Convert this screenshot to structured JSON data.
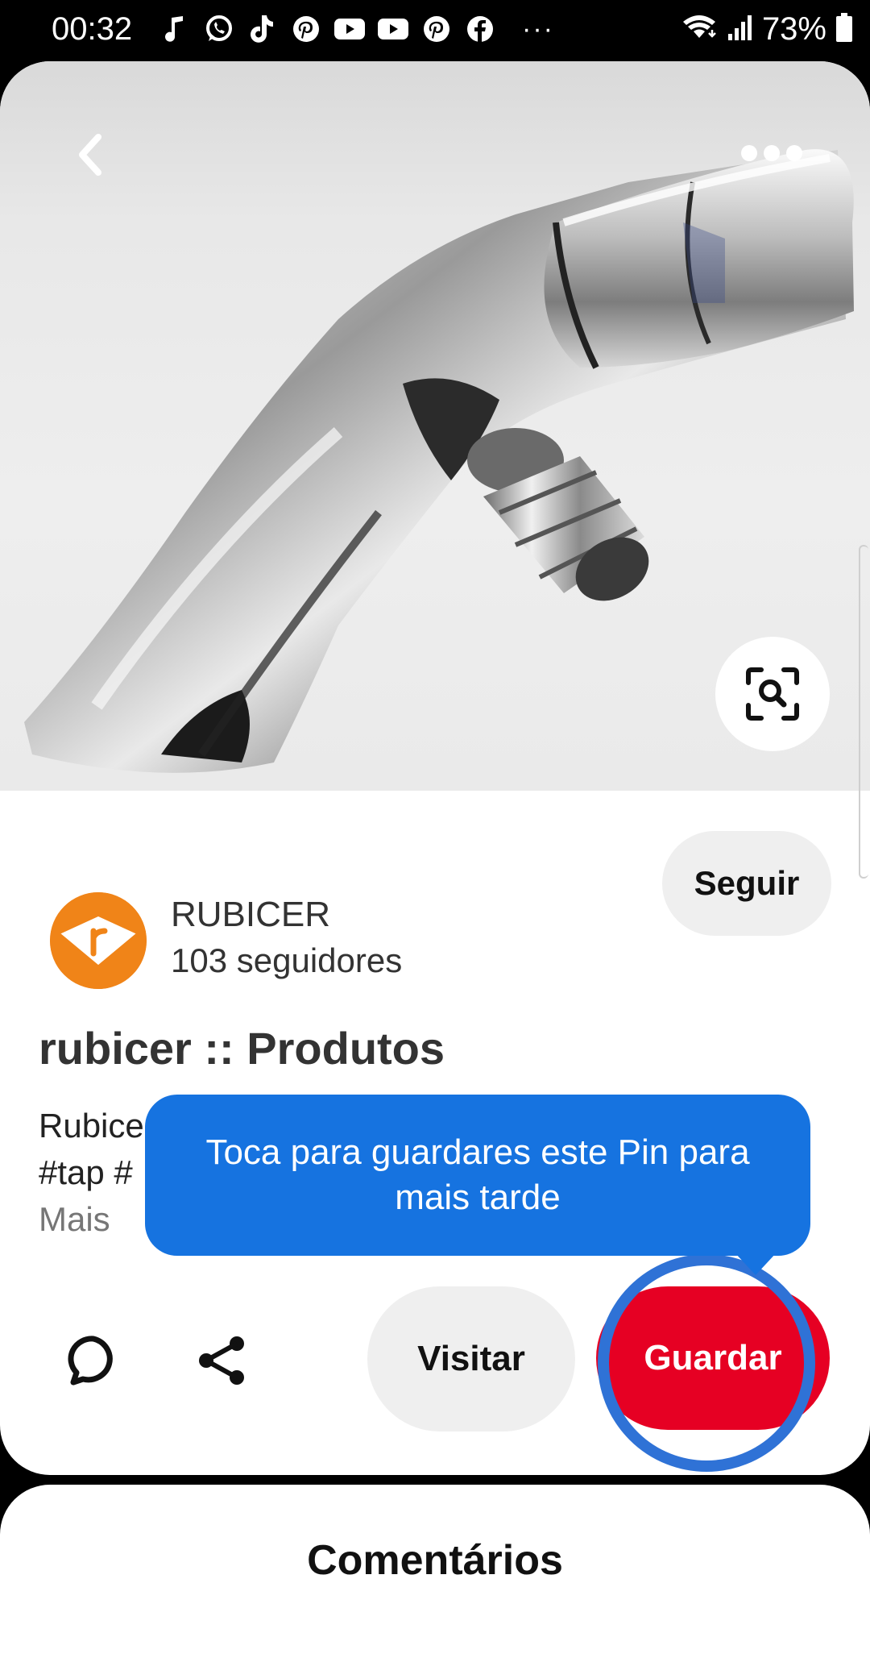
{
  "status_bar": {
    "time": "00:32",
    "battery": "73%",
    "more": "···",
    "app_icons": [
      "music-note-icon",
      "whatsapp-icon",
      "tiktok-icon",
      "pinterest-icon",
      "youtube-icon",
      "youtube-icon",
      "pinterest-icon",
      "facebook-icon"
    ],
    "system_icons": [
      "wifi-icon",
      "signal-icon",
      "battery-icon"
    ]
  },
  "pin": {
    "image_alt": "faucet-image",
    "toolbar": {
      "back_icon": "chevron-left-icon",
      "more_icon": "more-horizontal-icon",
      "lens_icon": "visual-search-icon"
    }
  },
  "creator": {
    "name": "RUBICER",
    "followers": "103 seguidores",
    "follow_label": "Seguir",
    "avatar_letter": "r"
  },
  "content": {
    "title": "rubicer :: Produtos",
    "desc_line1": "Rubice",
    "desc_line2": "#tap #",
    "more_label": "Mais"
  },
  "actions": {
    "visit_label": "Visitar",
    "save_label": "Guardar",
    "comment_icon": "comment-icon",
    "share_icon": "share-icon"
  },
  "tooltip": {
    "text": "Toca para guardares este Pin para mais tarde"
  },
  "comments": {
    "heading": "Comentários"
  },
  "colors": {
    "accent_red": "#e60023",
    "tooltip_blue": "#1673e0",
    "ring_blue": "#2f72d6",
    "brand_orange": "#f08418"
  }
}
